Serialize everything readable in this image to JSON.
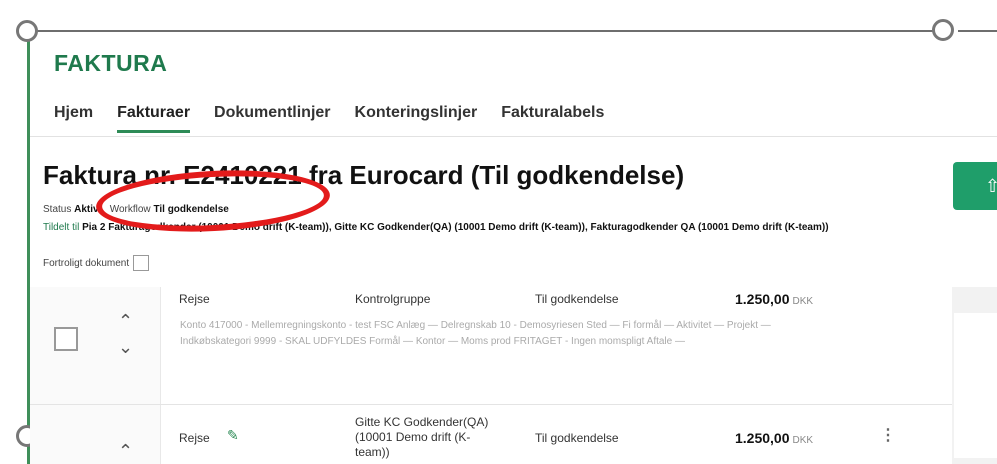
{
  "app_title": "FAKTURA",
  "nav": {
    "tabs": [
      {
        "label": "Hjem",
        "active": false
      },
      {
        "label": "Fakturaer",
        "active": true
      },
      {
        "label": "Dokumentlinjer",
        "active": false
      },
      {
        "label": "Konteringslinjer",
        "active": false
      },
      {
        "label": "Fakturalabels",
        "active": false
      }
    ]
  },
  "invoice": {
    "title": "Faktura nr. E2410221 fra Eurocard (Til godkendelse)",
    "status_label": "Status",
    "status_value": "Aktiv",
    "workflow_label": "Workflow",
    "workflow_value": "Til godkendelse",
    "assigned_label": "Tildelt til",
    "assigned_value": "Pia 2 Fakturagodkender (10001 Demo drift (K-team)), Gitte KC Godkender(QA) (10001 Demo drift (K-team)), Fakturagodkender QA (10001 Demo drift (K-team))",
    "confidential_label": "Fortroligt dokument"
  },
  "rows": [
    {
      "type": "Rejse",
      "approver": "Kontrolgruppe",
      "status": "Til godkendelse",
      "amount": "1.250,00",
      "currency": "DKK",
      "details": "Konto 417000 - Mellemregningskonto - test FSC  Anlæg  —  Delregnskab 10 - Demosyriesen  Sted  —  Fi formål  —  Aktivitet  —  Projekt  —  Indkøbskategori 9999 - SKAL UDFYLDES  Formål  —  Kontor  —  Moms prod FRITAGET - Ingen momspligt  Aftale  —"
    },
    {
      "type": "Rejse",
      "approver": "Gitte KC Godkender(QA) (10001 Demo drift (K-team))",
      "approver_lines": [
        "Gitte KC Godkender(QA)",
        "(10001 Demo drift (K-",
        "team))"
      ],
      "status": "Til godkendelse",
      "amount": "1.250,00",
      "currency": "DKK"
    }
  ],
  "colors": {
    "brand_green": "#1f7a4d",
    "annotation_red": "#e31b1b",
    "action_button": "#1f9e6a"
  },
  "icons": {
    "edit": "pencil-icon",
    "more": "kebab-menu-icon",
    "move_up": "chevron-up-icon",
    "move_down": "chevron-down-icon"
  }
}
